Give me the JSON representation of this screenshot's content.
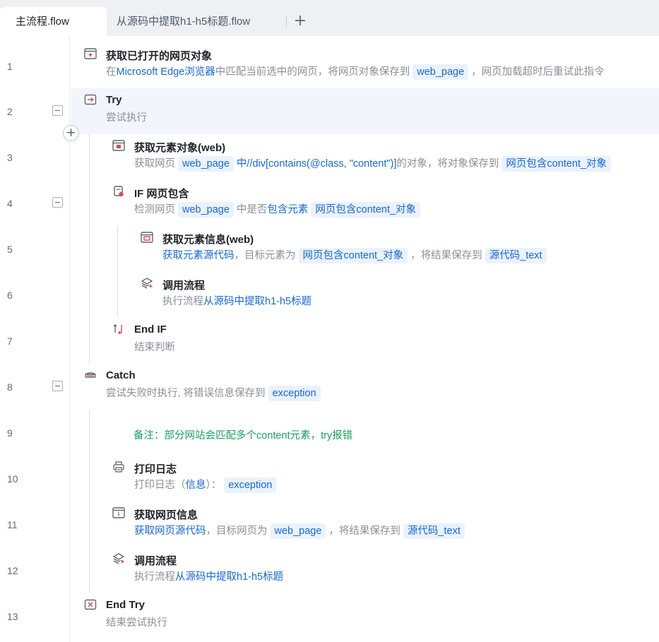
{
  "tabs": {
    "active": "主流程.flow",
    "inactive": "从源码中提取h1-h5标题.flow",
    "add": "+"
  },
  "gutter": {
    "line_numbers": [
      "1",
      "2",
      "3",
      "4",
      "5",
      "6",
      "7",
      "8",
      "9",
      "10",
      "11",
      "12",
      "13"
    ],
    "add_step": "+"
  },
  "rows": {
    "r1": {
      "title": "获取已打开的网页对象",
      "d0": "在",
      "d1": "Microsoft Edge浏览器",
      "d2": "中匹配当前选中的网页，将网页对象保存到",
      "d3": "web_page",
      "d4": "，网页加载超时后重试此指令"
    },
    "r2": {
      "title": "Try",
      "d0": "尝试执行"
    },
    "r3": {
      "title": "获取元素对象(web)",
      "d0": "获取网页",
      "d1": "web_page",
      "d2": "中",
      "d3": "//div[contains(@class, \"content\")]",
      "d4": "的对象，将对象保存到",
      "d5": "网页包含content_对象"
    },
    "r4": {
      "title": "IF 网页包含",
      "d0": "检测网页",
      "d1": "web_page",
      "d2": "中是否",
      "d3": "包含元素",
      "d4": "网页包含content_对象"
    },
    "r5": {
      "title": "获取元素信息(web)",
      "d0": "获取元素源代码",
      "d1": "，目标元素为",
      "d2": "网页包含content_对象",
      "d3": "，将结果保存到",
      "d4": "源代码_text"
    },
    "r6": {
      "title": "调用流程",
      "d0": "执行流程",
      "d1": "从源码中提取h1-h5标题"
    },
    "r7": {
      "title": "End IF",
      "d0": "结束判断"
    },
    "r8": {
      "title": "Catch",
      "d0": "尝试失败时执行, 将错误信息保存到",
      "d1": "exception"
    },
    "r9": {
      "comment": "备注：部分网站会匹配多个content元素，try报错"
    },
    "r10": {
      "title": "打印日志",
      "d0": "打印日志（",
      "d1": "信息",
      "d2": "）：",
      "d3": "exception"
    },
    "r11": {
      "title": "获取网页信息",
      "d0": "获取网页源代码",
      "d1": "，目标网页为",
      "d2": "web_page",
      "d3": "，将结果保存到",
      "d4": "源代码_text"
    },
    "r12": {
      "title": "调用流程",
      "d0": "执行流程",
      "d1": "从源码中提取h1-h5标题"
    },
    "r13": {
      "title": "End Try",
      "d0": "结束尝试执行"
    }
  },
  "colors": {
    "link": "#1668dc",
    "pill_bg": "#eaf2fd",
    "comment": "#1aa060",
    "highlight_row": "#f2f6fc",
    "icon_red": "#e5484d"
  },
  "icons": {
    "r1": "browser-window-icon",
    "r2": "try-icon",
    "r3": "browser-element-icon",
    "r4": "if-webpage-icon",
    "r5": "element-info-icon",
    "r6": "layers-icon",
    "r7": "end-if-icon",
    "r8": "catch-icon",
    "r10": "printer-icon",
    "r11": "page-info-icon",
    "r12": "layers-icon",
    "r13": "end-try-icon"
  }
}
